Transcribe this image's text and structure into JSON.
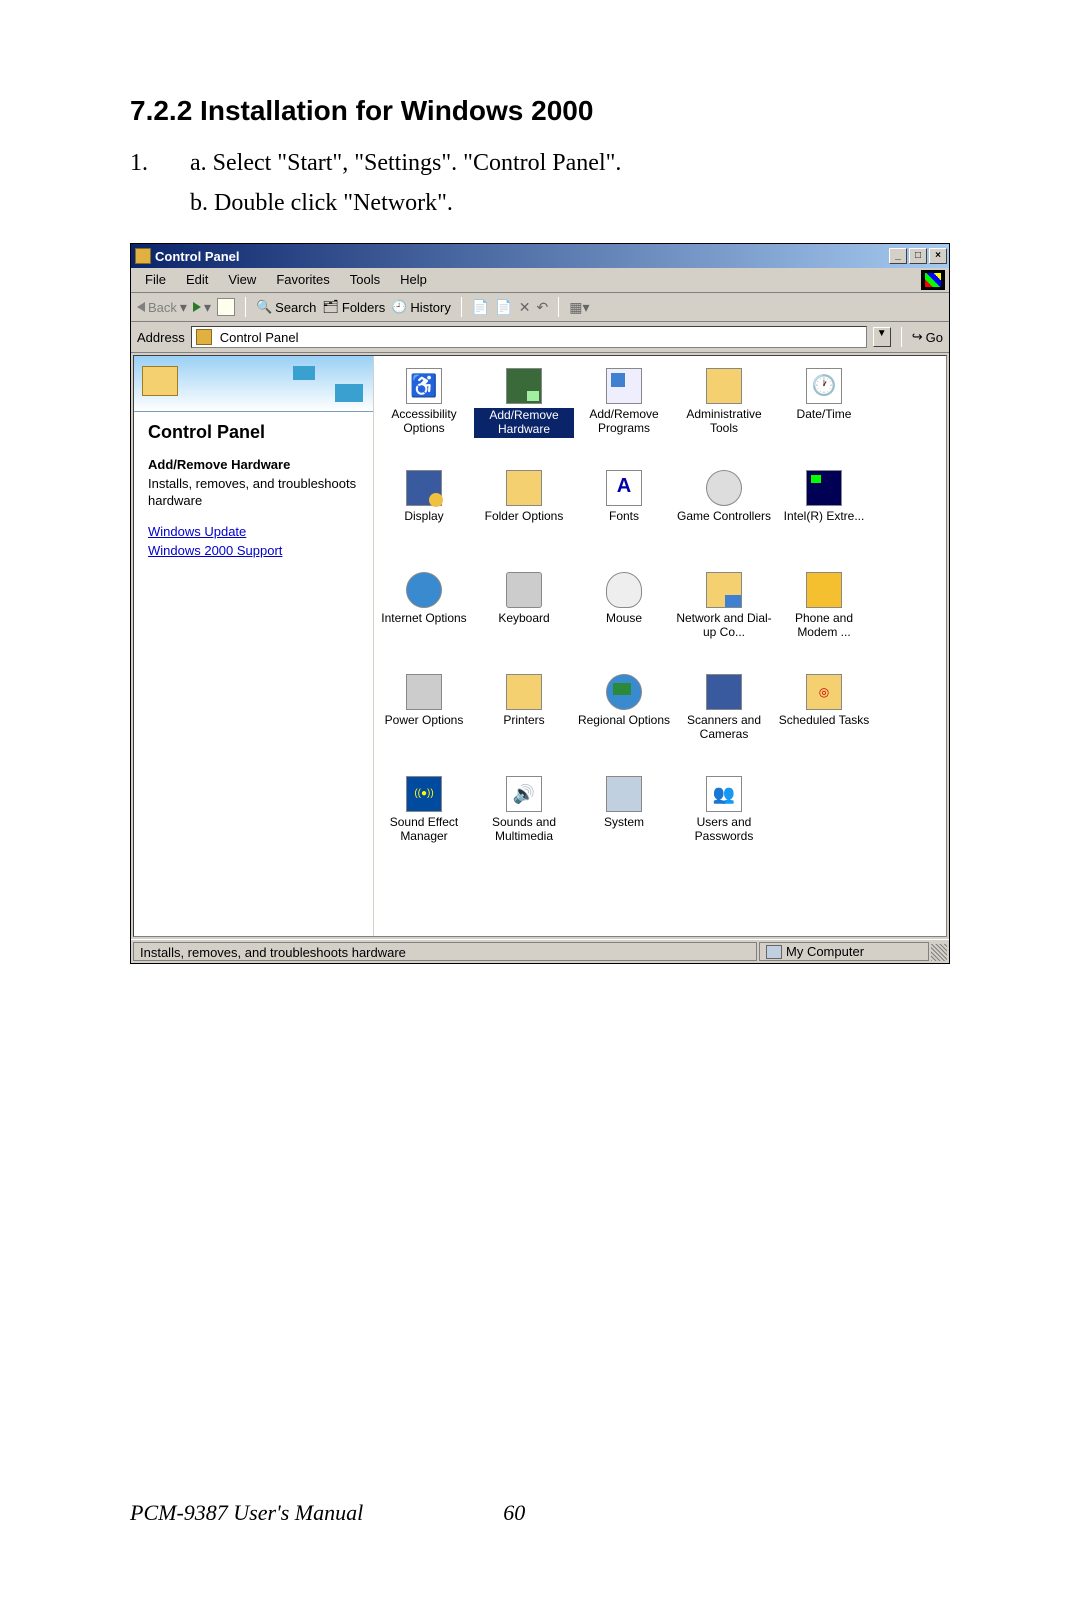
{
  "heading": "7.2.2 Installation for Windows 2000",
  "step_number": "1.",
  "step_a": "a. Select \"Start\", \"Settings\". \"Control Panel\".",
  "step_b": "b. Double click \"Network\".",
  "window": {
    "title": "Control Panel",
    "min": "_",
    "max": "□",
    "close": "×"
  },
  "menubar": {
    "file": "File",
    "edit": "Edit",
    "view": "View",
    "favorites": "Favorites",
    "tools": "Tools",
    "help": "Help"
  },
  "toolbar": {
    "back": "Back",
    "search": "Search",
    "folders": "Folders",
    "history": "History"
  },
  "addressbar": {
    "label": "Address",
    "value": "Control Panel",
    "go": "Go"
  },
  "sidebar": {
    "title": "Control Panel",
    "selected": "Add/Remove Hardware",
    "desc": "Installs, removes, and troubleshoots hardware",
    "link1": "Windows Update",
    "link2": "Windows 2000 Support"
  },
  "items": [
    {
      "label": "Accessibility Options",
      "ic": "ic-access"
    },
    {
      "label": "Add/Remove Hardware",
      "ic": "ic-addhw",
      "selected": true
    },
    {
      "label": "Add/Remove Programs",
      "ic": "ic-addprog"
    },
    {
      "label": "Administrative Tools",
      "ic": "ic-admin"
    },
    {
      "label": "Date/Time",
      "ic": "ic-date"
    },
    {
      "label": "Display",
      "ic": "ic-display"
    },
    {
      "label": "Folder Options",
      "ic": "ic-folder"
    },
    {
      "label": "Fonts",
      "ic": "ic-fonts"
    },
    {
      "label": "Game Controllers",
      "ic": "ic-game"
    },
    {
      "label": "Intel(R) Extre...",
      "ic": "ic-intel"
    },
    {
      "label": "Internet Options",
      "ic": "ic-ie"
    },
    {
      "label": "Keyboard",
      "ic": "ic-kbd"
    },
    {
      "label": "Mouse",
      "ic": "ic-mouse"
    },
    {
      "label": "Network and Dial-up Co...",
      "ic": "ic-net"
    },
    {
      "label": "Phone and Modem ...",
      "ic": "ic-phone"
    },
    {
      "label": "Power Options",
      "ic": "ic-power"
    },
    {
      "label": "Printers",
      "ic": "ic-print"
    },
    {
      "label": "Regional Options",
      "ic": "ic-region"
    },
    {
      "label": "Scanners and Cameras",
      "ic": "ic-scan"
    },
    {
      "label": "Scheduled Tasks",
      "ic": "ic-sched"
    },
    {
      "label": "Sound Effect Manager",
      "ic": "ic-sfx"
    },
    {
      "label": "Sounds and Multimedia",
      "ic": "ic-sound"
    },
    {
      "label": "System",
      "ic": "ic-system"
    },
    {
      "label": "Users and Passwords",
      "ic": "ic-users"
    }
  ],
  "statusbar": {
    "left": "Installs, removes, and troubleshoots hardware",
    "right": "My Computer"
  },
  "footer": {
    "title": "PCM-9387 User's Manual",
    "page": "60"
  }
}
